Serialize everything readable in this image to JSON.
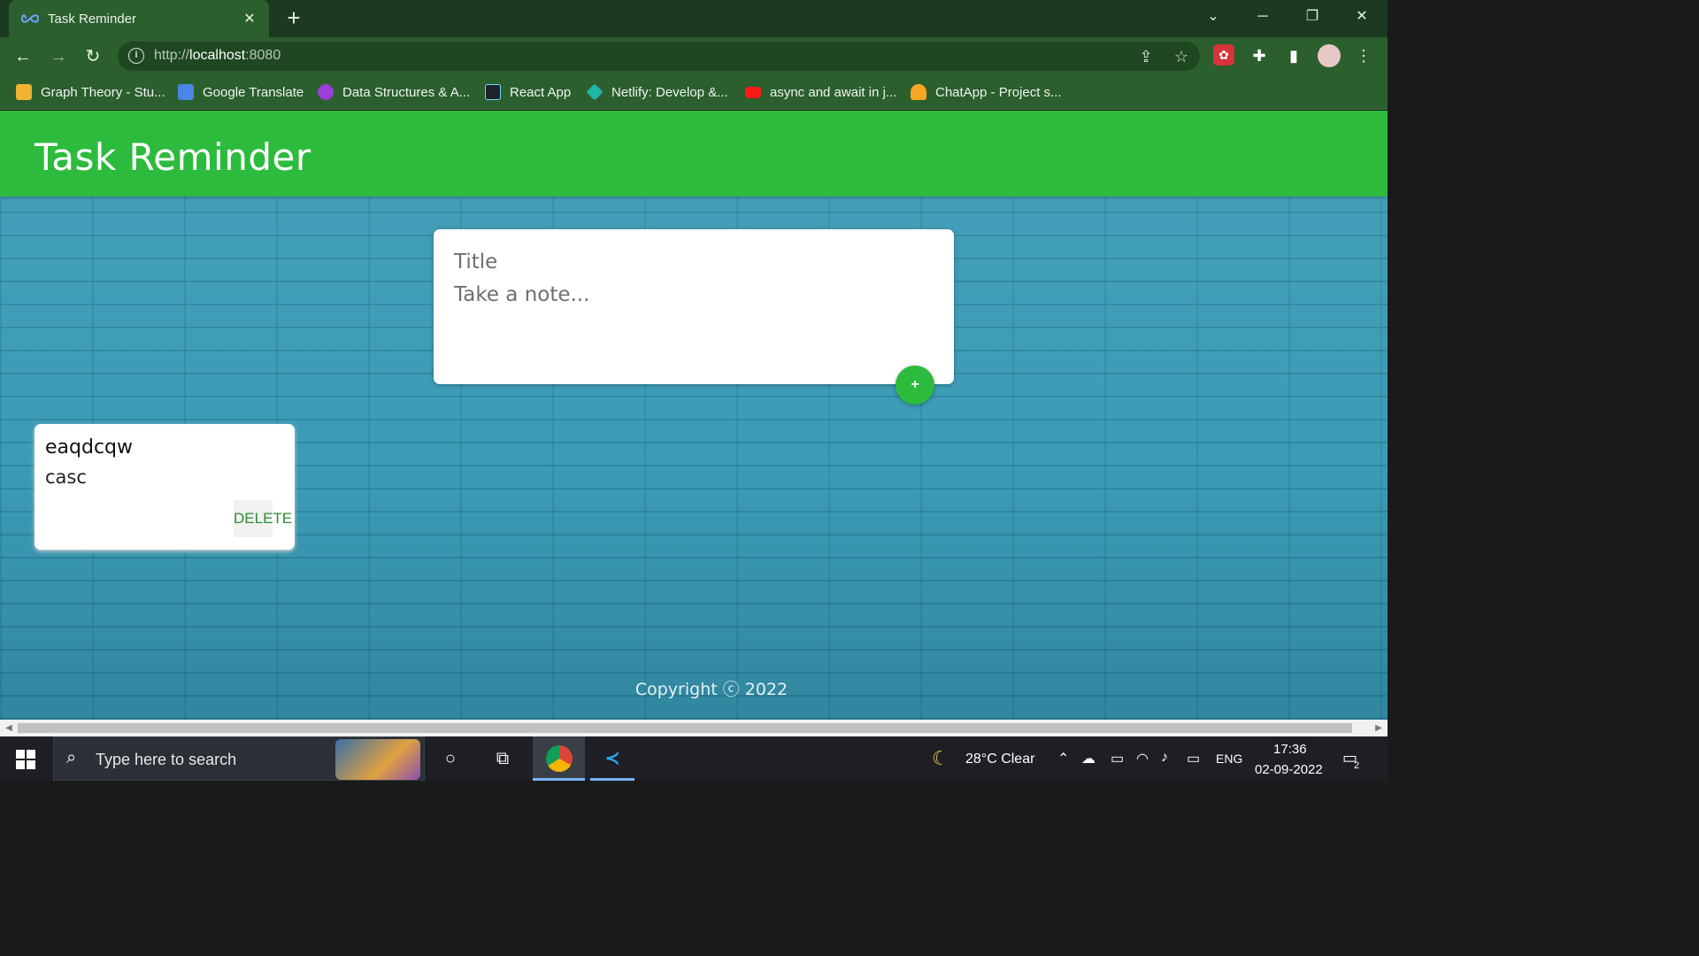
{
  "browser": {
    "tab_title": "Task Reminder",
    "url_prefix": "http://",
    "url_host": "localhost",
    "url_suffix": ":8080",
    "bookmarks": [
      {
        "label": "Graph Theory - Stu...",
        "icon_color": "#f2b233"
      },
      {
        "label": "Google Translate",
        "icon_color": "#4a86e8"
      },
      {
        "label": "Data Structures & A...",
        "icon_color": "#9b3fd6"
      },
      {
        "label": "React App",
        "icon_color": "#61dafb"
      },
      {
        "label": "Netlify: Develop &...",
        "icon_color": "#21b5a6"
      },
      {
        "label": "async and await in j...",
        "icon_color": "#ff1a1a"
      },
      {
        "label": "ChatApp - Project s...",
        "icon_color": "#f5a623"
      }
    ]
  },
  "app": {
    "title": "Task Reminder",
    "accent": "#2dbb3d",
    "create": {
      "title_placeholder": "Title",
      "body_placeholder": "Take a note...",
      "add_label": "+"
    },
    "notes": [
      {
        "title": "eaqdcqw",
        "content": "casc",
        "delete_label": "DELETE"
      }
    ],
    "footer": "Copyright ⓒ 2022"
  },
  "taskbar": {
    "search_placeholder": "Type here to search",
    "weather": "28°C  Clear",
    "language": "ENG",
    "time": "17:36",
    "date": "02-09-2022",
    "notification_count": "2"
  }
}
